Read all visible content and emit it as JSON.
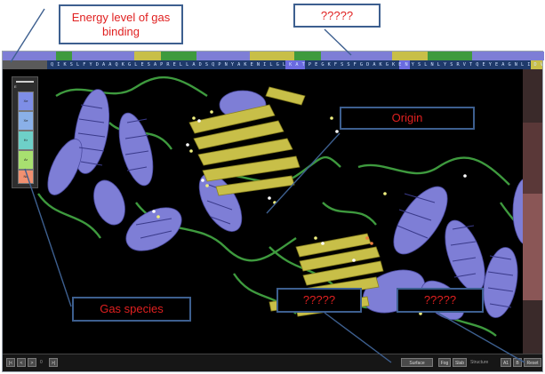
{
  "callouts": {
    "energy": "Energy level of gas binding",
    "top_unknown": "?????",
    "origin": "Origin",
    "gas_species": "Gas species",
    "mid_unknown": "?????",
    "right_unknown": "?????"
  },
  "sequence": {
    "residues": "Q I K S L F Y D A A Q K G L E S A P R E L L A D S Q P N Y A K E N I L G L K A T P E G K F S S F G D A K G K E N Y S L N L Y S R V T Q E Y E A G N L I D V E G K K D I N L"
  },
  "gas_panel": {
    "slider_label": "E",
    "species": [
      "Xe",
      "Xe",
      "Kr",
      "Ar",
      "Ne"
    ]
  },
  "bottom_bar": {
    "left_buttons": [
      "|<",
      "<",
      ">",
      ">|"
    ],
    "left_text": "0",
    "center_button": "Surface",
    "mid_buttons": [
      "Fog",
      "Slab"
    ],
    "right_text": "Structure",
    "right_buttons": [
      "A1",
      "B",
      "Reset"
    ]
  },
  "colors": {
    "helix": "#7e7ed6",
    "sheet": "#c8bf48",
    "coil": "#3e9a3e",
    "callout_border": "#3d5f8f",
    "callout_text": "#e02020"
  }
}
